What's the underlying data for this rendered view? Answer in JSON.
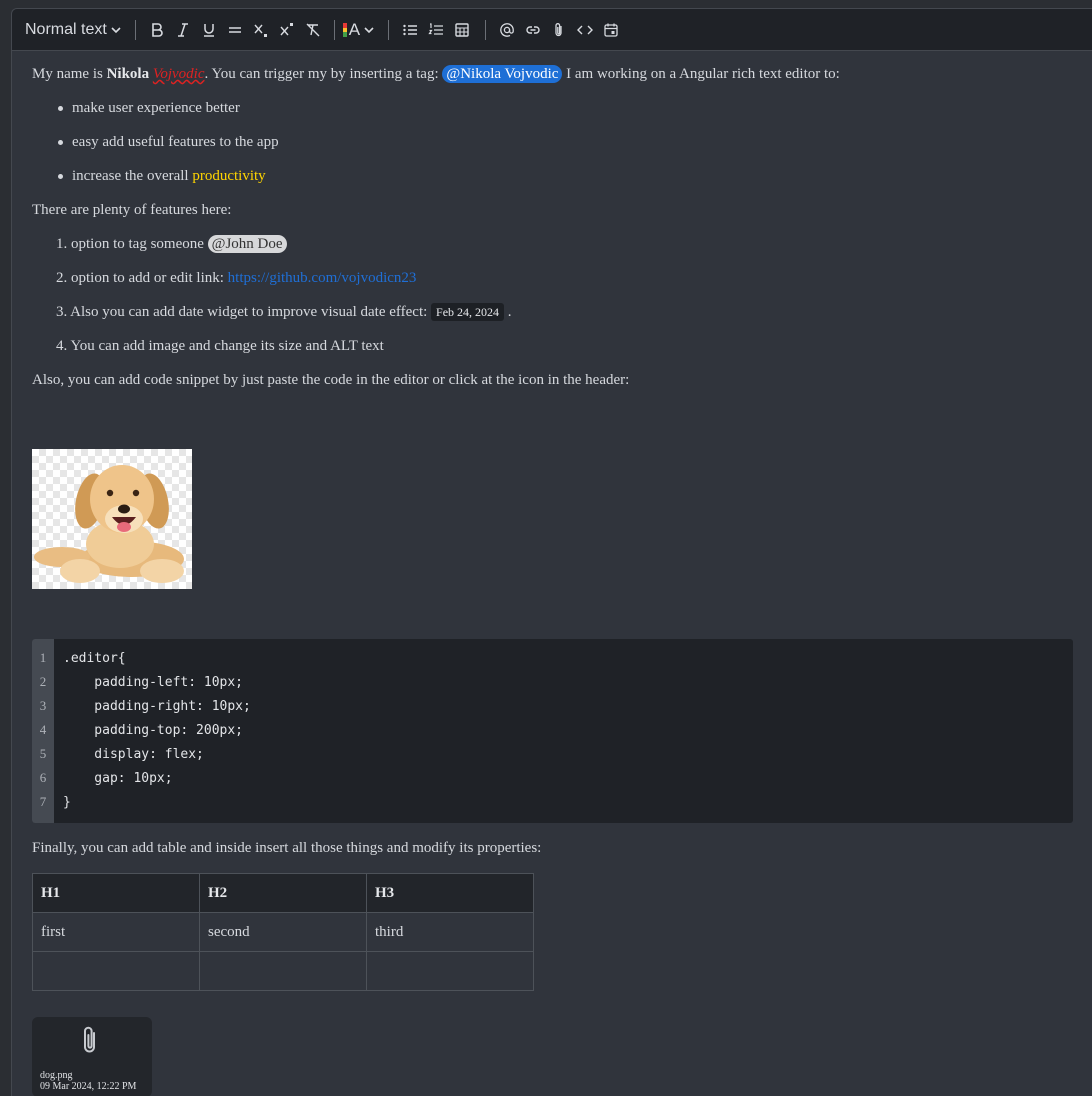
{
  "toolbar": {
    "text_style": "Normal text",
    "color_label": "A"
  },
  "content": {
    "intro": {
      "p1": "My name is ",
      "name_bold": "Nikola",
      "name_err": "Vojvodic",
      "p2": ". You can trigger my by inserting a tag: ",
      "mention": "@Nikola Vojvodic",
      "p3": " I am working on a Angular rich text editor to:"
    },
    "bullets": [
      {
        "text": "make user experience better",
        "highlight": ""
      },
      {
        "text": "easy add useful features to the app",
        "highlight": ""
      },
      {
        "text": "increase the overall ",
        "highlight": "productivity"
      }
    ],
    "features_heading": "There are plenty of features here:",
    "numbered": {
      "item1_prefix": "1.  option to tag someone ",
      "item1_mention": "@John Doe",
      "item2_prefix": "2.  option to add or edit link: ",
      "item2_link": "https://github.com/vojvodicn23",
      "item3_prefix": "3. Also you can add date widget to improve visual date effect: ",
      "item3_date": "Feb 24, 2024",
      "item3_suffix": " .",
      "item4": "4. You can add image and change its size and ALT text"
    },
    "code_heading": "Also, you can add code snippet by just paste the code in the editor or click at the icon in the header:",
    "code_lines": [
      {
        "n": "1",
        "text": ".editor{"
      },
      {
        "n": "2",
        "text": "    padding-left: 10px;"
      },
      {
        "n": "3",
        "text": "    padding-right: 10px;"
      },
      {
        "n": "4",
        "text": "    padding-top: 200px;"
      },
      {
        "n": "5",
        "text": "    display: flex;"
      },
      {
        "n": "6",
        "text": "    gap: 10px;"
      },
      {
        "n": "7",
        "text": "}"
      }
    ],
    "table_heading": "Finally, you can add table and inside insert all those things and modify its properties:",
    "table": {
      "headers": [
        "H1",
        "H2",
        "H3"
      ],
      "rows": [
        [
          "first",
          "second",
          "third"
        ],
        [
          "",
          "",
          ""
        ]
      ]
    },
    "attachment": {
      "name": "dog.png",
      "date": "09 Mar 2024, 12:22 PM"
    }
  },
  "colors": {
    "background": "#30343c",
    "toolbar": "#1f2227",
    "mention": "#1e6fd6",
    "link": "#1f6fd6",
    "highlight": "#ffd500"
  }
}
